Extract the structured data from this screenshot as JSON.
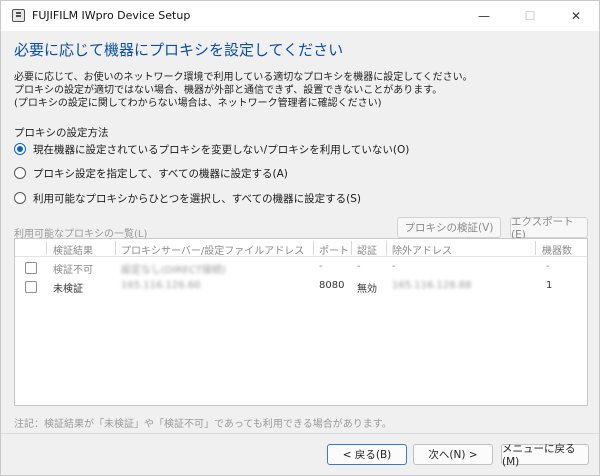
{
  "window": {
    "title": "FUJIFILM IWpro Device Setup",
    "minimize_glyph": "—",
    "maximize_glyph": "☐",
    "close_glyph": "✕"
  },
  "heading": "必要に応じて機器にプロキシを設定してください",
  "intro": [
    "必要に応じて、お使いのネットワーク環境で利用している適切なプロキシを機器に設定してください。",
    "プロキシの設定が適切ではない場合、機器が外部と通信できず、設置できないことがあります。",
    "(プロキシの設定に関してわからない場合は、ネットワーク管理者に確認ください)"
  ],
  "proxy_method_label": "プロキシの設定方法",
  "radio_options": [
    {
      "label": "現在機器に設定されているプロキシを変更しない/プロキシを利用していない(O)",
      "checked": true
    },
    {
      "label": "プロキシ設定を指定して、すべての機器に設定する(A)",
      "checked": false
    },
    {
      "label": "利用可能なプロキシからひとつを選択し、すべての機器に設定する(S)",
      "checked": false
    }
  ],
  "proxy_list": {
    "label": "利用可能なプロキシの一覧(L)",
    "verify_button": "プロキシの検証(V)",
    "export_button": "エクスポート(E)",
    "columns": [
      "検証結果",
      "プロキシサーバー/設定ファイルアドレス",
      "ポート",
      "認証",
      "除外アドレス",
      "機器数"
    ],
    "rows": [
      {
        "result": "検証不可",
        "address": "設定なし(DIRECT接続)",
        "port": "-",
        "auth": "-",
        "exclude": "-",
        "count": "-"
      },
      {
        "result": "未検証",
        "address": "165.116.126.60",
        "port": "8080",
        "auth": "無効",
        "exclude": "165.116.128.88",
        "count": "1"
      }
    ]
  },
  "note": "注記：検証結果が「未検証」や「検証不可」であっても利用できる場合があります。",
  "footer": {
    "back": "< 戻る(B)",
    "next": "次へ(N) >",
    "menu": "メニューに戻る(M)"
  },
  "colors": {
    "heading": "#0b4fa3",
    "accent": "#0a64c8",
    "muted_text": "#9a9a9a"
  }
}
